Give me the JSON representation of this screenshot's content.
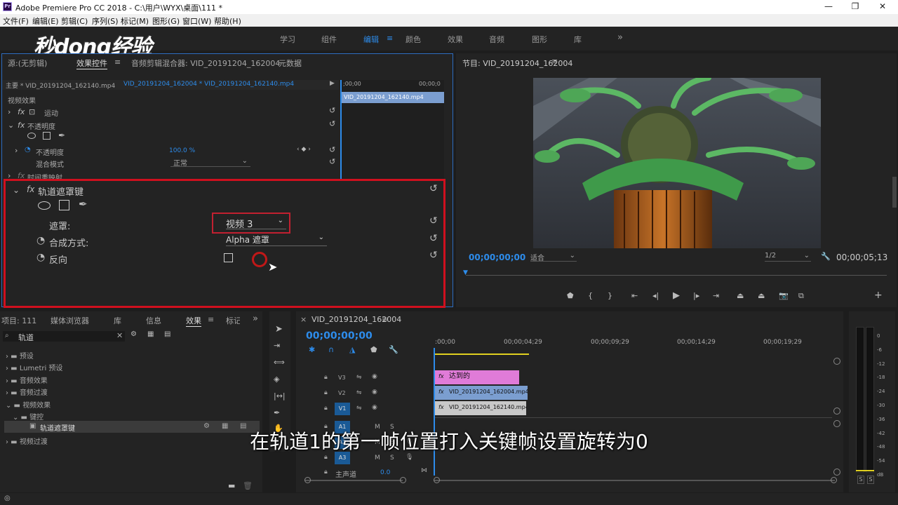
{
  "window": {
    "title": "Adobe Premiere Pro CC 2018 - C:\\用户\\WYX\\桌面\\111 *",
    "app_icon": "Pr",
    "minimize": "—",
    "maximize": "❐",
    "close": "✕"
  },
  "menu": [
    "文件(F)",
    "编辑(E)",
    "剪辑(C)",
    "序列(S)",
    "标记(M)",
    "图形(G)",
    "窗口(W)",
    "帮助(H)"
  ],
  "workspaces": [
    "学习",
    "组件",
    "编辑",
    "颜色",
    "效果",
    "音频",
    "图形",
    "库"
  ],
  "workspaces_more": "»",
  "watermark": "秒dong经验",
  "source_tabs": [
    "源:(无剪辑)",
    "效果控件",
    "音频剪辑混合器: VID_20191204_162004",
    "元数据"
  ],
  "ec": {
    "master": "主要 * VID_20191204_162140.mp4",
    "sequence": "VID_20191204_162004 * VID_20191204_162140.mp4",
    "time_start": ";00;00",
    "time_end": "00;00;0",
    "clip": "VID_20191204_162140.mp4",
    "video_effects": "视频效果",
    "motion": "运动",
    "opacity": "不透明度",
    "opacity_label": "不透明度",
    "opacity_value": "100.0 %",
    "blend_mode": "混合模式",
    "blend_value": "正常",
    "time_remap": "时间重映射",
    "track_matte": "轨道遮罩键",
    "matte_label": "遮罩:",
    "matte_value": "视频 3",
    "composite_label": "合成方式:",
    "composite_value": "Alpha 遮罩",
    "reverse": "反向"
  },
  "program": {
    "title": "节目: VID_20191204_162004",
    "timecode": "00;00;00;00",
    "fit": "适合",
    "resolution": "1/2",
    "duration": "00;00;05;13"
  },
  "project_tabs": [
    "项目: 111",
    "媒体浏览器",
    "库",
    "信息",
    "效果",
    "标记"
  ],
  "project_more": "»",
  "search_value": "轨道",
  "effects_tree": [
    "预设",
    "Lumetri 预设",
    "音频效果",
    "音频过渡",
    "视频效果",
    "键控",
    "轨道遮罩键",
    "视频过渡"
  ],
  "timeline": {
    "tab": "VID_20191204_162004",
    "timecode": "00;00;00;00",
    "ticks": [
      ":00;00",
      "00;00;04;29",
      "00;00;09;29",
      "00;00;14;29",
      "00;00;19;29"
    ],
    "tracks": [
      "V3",
      "V2",
      "V1",
      "A1",
      "A2",
      "A3"
    ],
    "master": "主声道",
    "master_value": "0.0",
    "clips": {
      "v3": "达到的",
      "v2": "VID_20191204_162004.mp4",
      "v1": "VID_20191204_162140.mp4"
    }
  },
  "meter": {
    "labels": [
      "0",
      "-6",
      "-12",
      "-18",
      "-24",
      "-30",
      "-36",
      "-42",
      "-48",
      "-54",
      "dB"
    ],
    "solo": [
      "S",
      "S"
    ]
  },
  "subtitle": "在轨道1的第一帧位置打入关键帧设置旋转为0",
  "colors": {
    "accent": "#2d8ceb",
    "highlight": "#d0101e",
    "clip_pink": "#e07bd8",
    "clip_blue": "#7b9ed0",
    "clip_gray": "#c8c8c8"
  }
}
